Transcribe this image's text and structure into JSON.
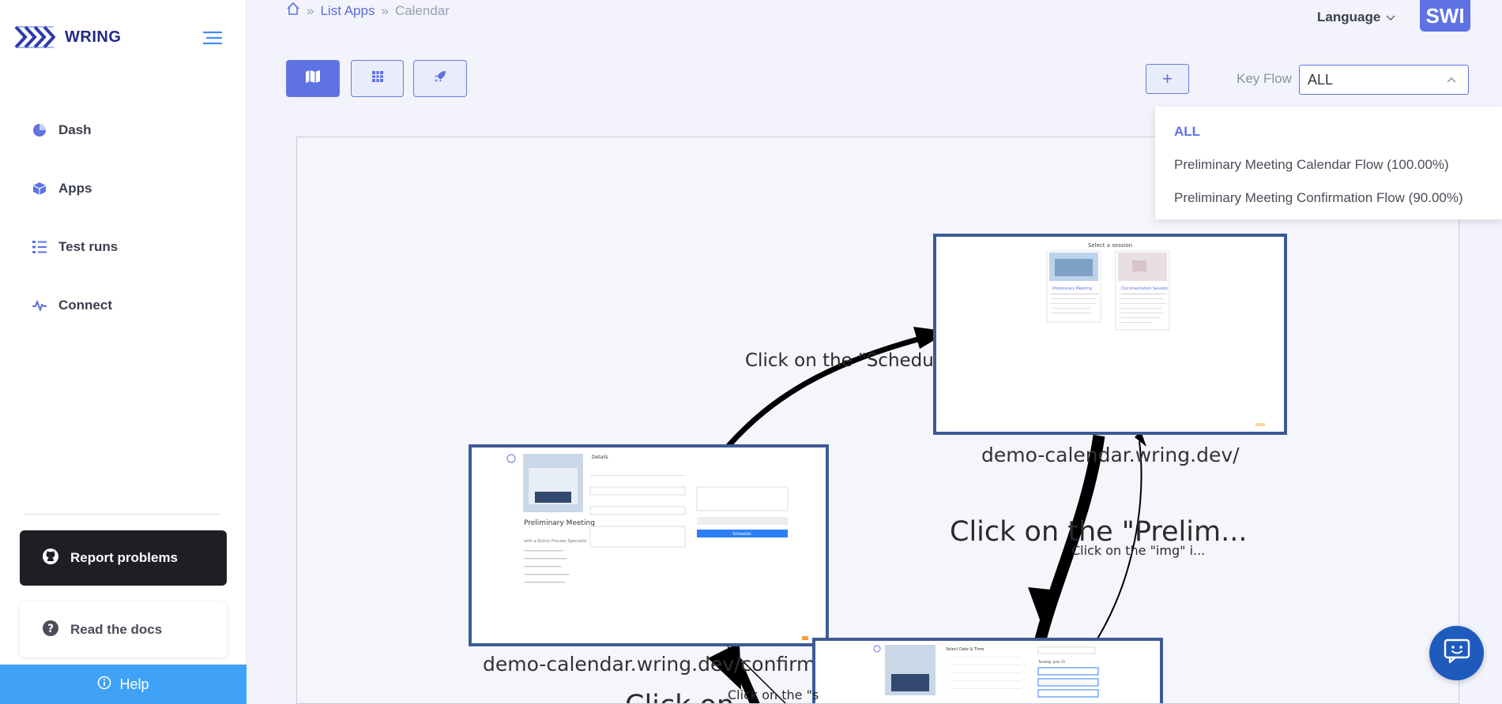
{
  "brand": {
    "name": "WRING",
    "logo_icon": "wring-logo-icon"
  },
  "sidebar": {
    "items": [
      {
        "label": "Dash",
        "icon": "pie-chart-icon"
      },
      {
        "label": "Apps",
        "icon": "cube-icon"
      },
      {
        "label": "Test runs",
        "icon": "list-icon"
      },
      {
        "label": "Connect",
        "icon": "pulse-icon"
      }
    ],
    "report_label": "Report problems",
    "docs_label": "Read the docs",
    "help_label": "Help"
  },
  "breadcrumb": {
    "home_icon": "home-icon",
    "apps_label": "List Apps",
    "current_label": "Calendar"
  },
  "header": {
    "language_label": "Language",
    "avatar_text": "SWI"
  },
  "toolbar": {
    "views": [
      {
        "icon": "map-icon",
        "active": true
      },
      {
        "icon": "grid-icon",
        "active": false
      },
      {
        "icon": "rocket-icon",
        "active": false
      }
    ],
    "add_label": "+"
  },
  "key_flow": {
    "label": "Key Flow",
    "selected": "ALL",
    "options": [
      "ALL",
      "Preliminary Meeting Calendar Flow (100.00%)",
      "Preliminary Meeting Confirmation Flow (90.00%)"
    ]
  },
  "graph": {
    "nodes": [
      {
        "url": "demo-calendar.wring.dev/",
        "thumb_title": "Select a session",
        "thumb_items": [
          "Preliminary Meeting",
          "Documentation Session"
        ]
      },
      {
        "url": "demo-calendar.wring.dev/confirm",
        "thumb_title": "Details",
        "thumb_items": [
          "Preliminary Meeting",
          "with a Quinty Process Specialist",
          "Schedule"
        ]
      },
      {
        "url": "",
        "thumb_title": "Select Date & Time",
        "thumb_items": [
          "Tuesday, June 15"
        ]
      }
    ],
    "edges": [
      {
        "label": "Click on the \"Schedu"
      },
      {
        "label": "Click on the \"Prelim..."
      },
      {
        "label": "Click on the \"img\" i..."
      },
      {
        "label": "Click on the \"s"
      },
      {
        "label": "Click on..."
      }
    ]
  },
  "colors": {
    "accent": "#5e72e4",
    "node_border": "#3d5a96",
    "sidebar_brand": "#1f2a86",
    "help": "#3fa2f7",
    "report": "#1d1f23"
  },
  "chat": {
    "icon": "chat-bot-icon"
  }
}
